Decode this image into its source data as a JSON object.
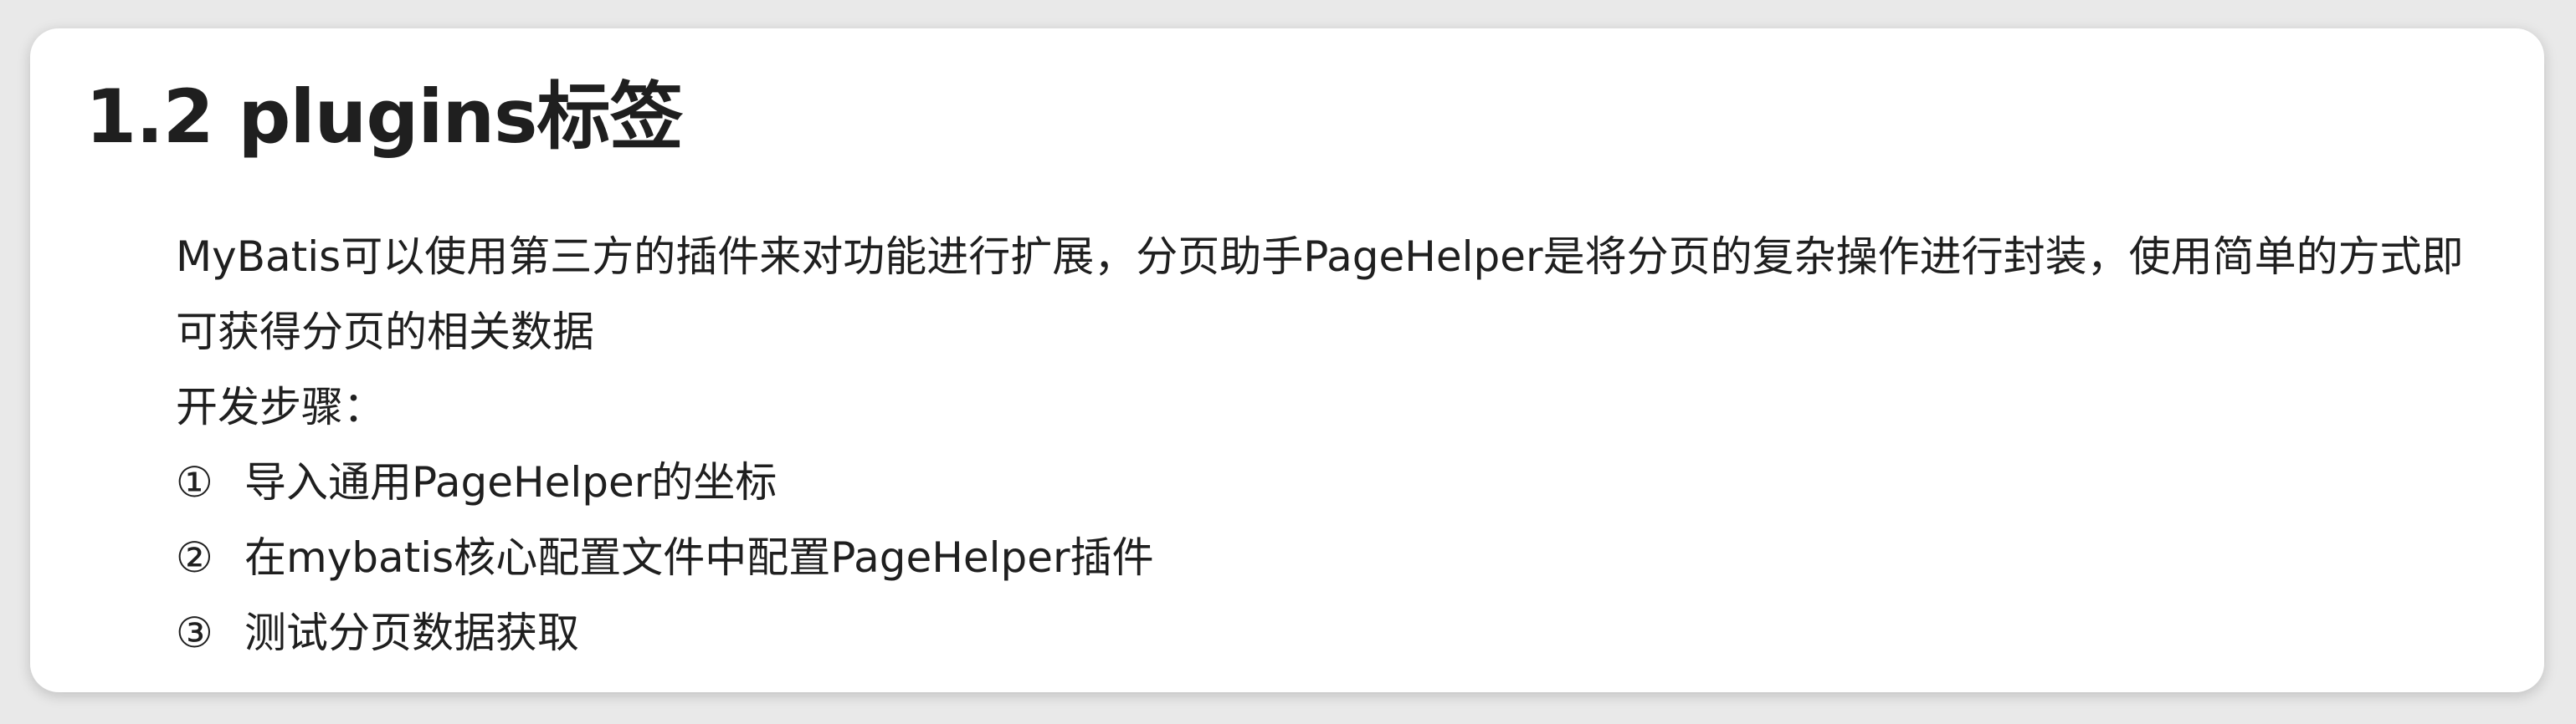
{
  "document": {
    "title": "1.2 plugins标签",
    "paragraph_lines": [
      "MyBatis可以使用第三方的插件来对功能进行扩展，分页助手PageHelper是将分页的复杂操作进行封装，使用简单的方式即",
      "可获得分页的相关数据"
    ],
    "steps_heading": "开发步骤：",
    "steps": [
      {
        "number": "①",
        "text": "导入通用PageHelper的坐标"
      },
      {
        "number": "②",
        "text": "在mybatis核心配置文件中配置PageHelper插件"
      },
      {
        "number": "③",
        "text": "测试分页数据获取"
      }
    ]
  }
}
